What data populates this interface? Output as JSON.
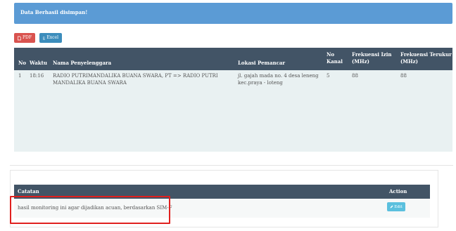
{
  "alert": {
    "message": "Data Berhasil disimpan!",
    "color": "#5b9bd5"
  },
  "toolbar": {
    "pdf_label": "PDF",
    "excel_label": "Excel",
    "pdf_color": "#d9534f",
    "excel_color": "#3c8dbc"
  },
  "monitoring_table": {
    "headers": {
      "no": "No",
      "waktu": "Waktu",
      "nama": "Nama Penyelenggara",
      "lokasi": "Lokasi Pemancar",
      "kanal_line1": "No",
      "kanal_line2": "Kanal",
      "izin_line1": "Frekuensi Izin",
      "izin_line2": "(MHz)",
      "terukur_line1": "Frekuensi Terukur",
      "terukur_line2": "(MHz)"
    },
    "rows": [
      {
        "no": "1",
        "waktu": "18:16",
        "nama_line1": "RADIO PUTRIMANDALIKA BUANA SWARA, PT => RADIO PUTRI",
        "nama_line2": "MANDALIKA BUANA SWARA",
        "lokasi_line1": "jl. gajah mada no. 4 desa leneng",
        "lokasi_line2": "kec.praya - loteng",
        "kanal": "5",
        "frekuensi_izin": "88",
        "frekuensi_terukur": "88"
      }
    ]
  },
  "notes_table": {
    "headers": {
      "catatan": "Catatan",
      "action": "Action"
    },
    "rows": [
      {
        "catatan": "hasil monitoring ini agar dijadikan acuan, berdasarkan SIM-F",
        "edit_label": "Edit"
      }
    ]
  },
  "colors": {
    "header_bg": "#425466",
    "row_bg": "#e9f1f2",
    "highlight": "#e0201e",
    "edit_button": "#5bc0de"
  }
}
